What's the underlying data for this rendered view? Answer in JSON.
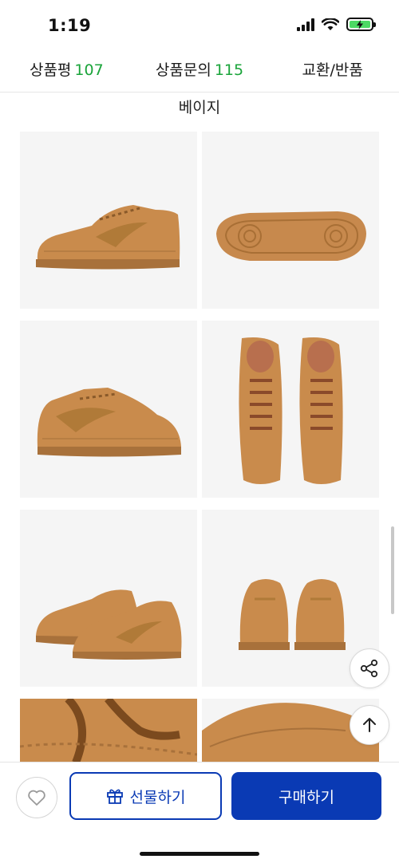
{
  "status_bar": {
    "time": "1:19"
  },
  "tabs": [
    {
      "label": "상품평",
      "count": "107"
    },
    {
      "label": "상품문의",
      "count": "115"
    },
    {
      "label": "교환/반품",
      "count": ""
    }
  ],
  "color_label": "베이지",
  "product_images": [
    {
      "icon": "sneaker-side-view"
    },
    {
      "icon": "sneaker-outsole-view"
    },
    {
      "icon": "sneaker-side-view"
    },
    {
      "icon": "sneaker-top-view"
    },
    {
      "icon": "sneaker-pair-angle-view"
    },
    {
      "icon": "sneaker-heel-view"
    },
    {
      "icon": "sneaker-laces-closeup"
    },
    {
      "icon": "sneaker-toe-closeup"
    }
  ],
  "floating": {
    "share_icon": "share-icon",
    "top_icon": "arrow-up-icon"
  },
  "bottom_bar": {
    "like_icon": "heart-icon",
    "gift_label": "선물하기",
    "buy_label": "구매하기"
  },
  "colors": {
    "accent": "#0a3ab4",
    "count_green": "#1aa43a",
    "shoe_tan": "#c88a4a"
  }
}
